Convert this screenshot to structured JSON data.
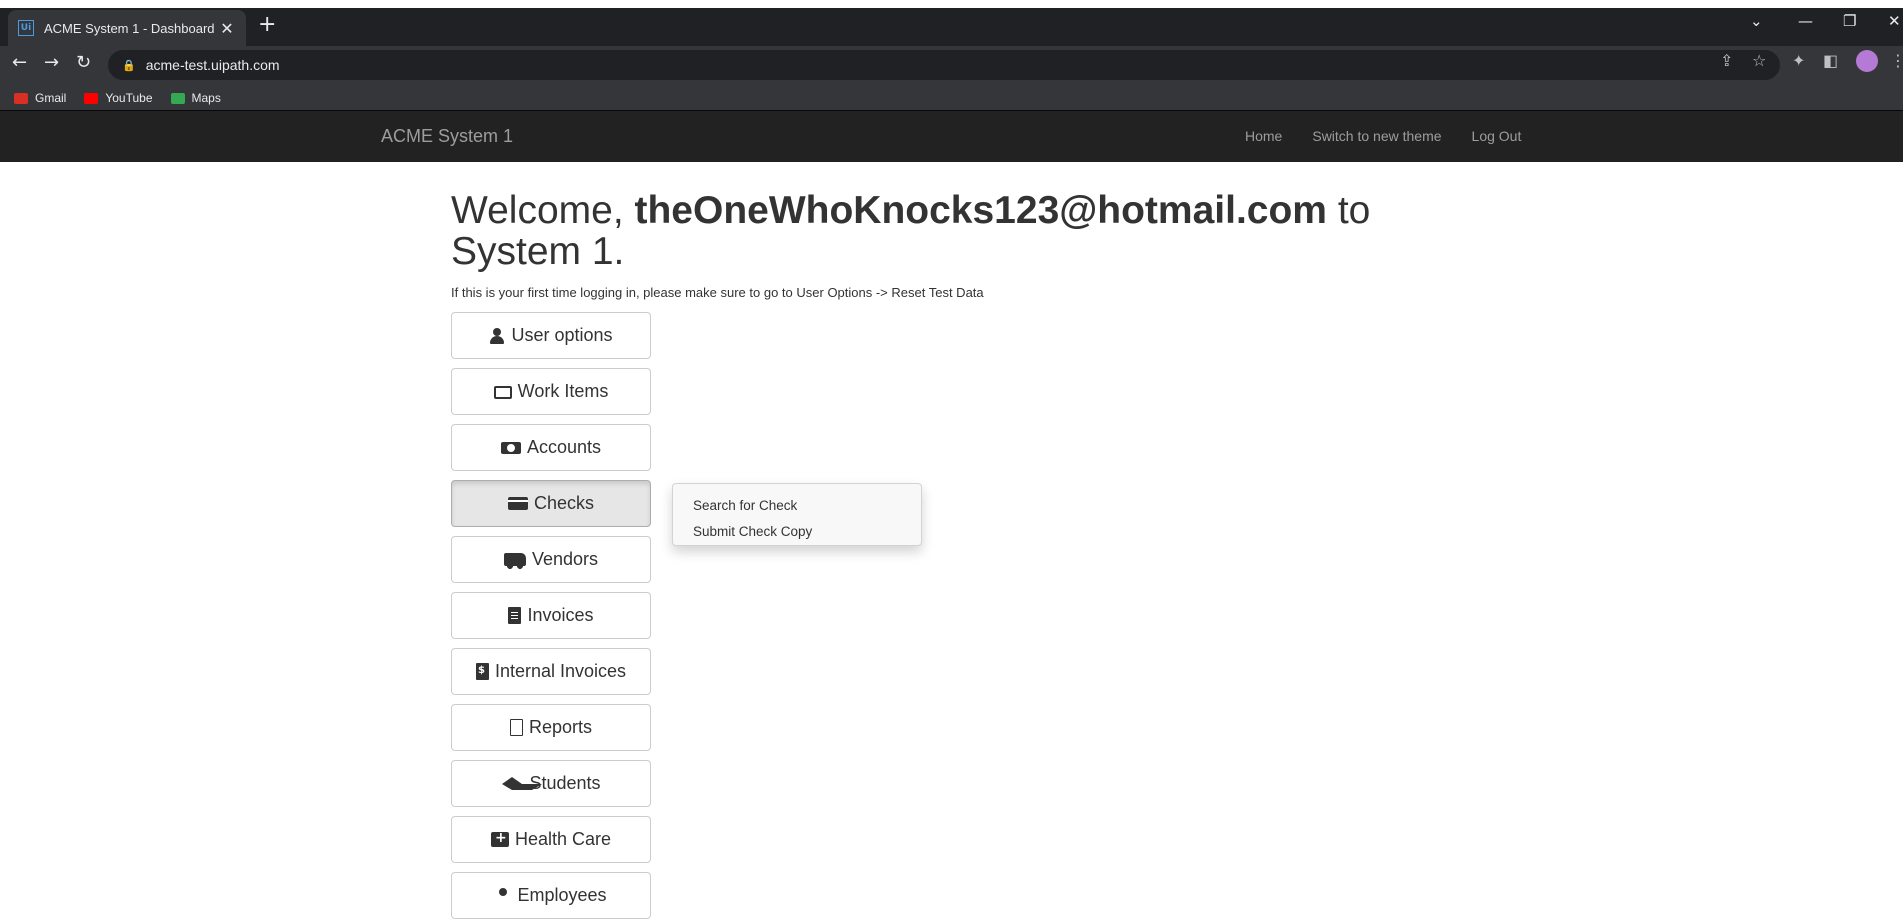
{
  "browser": {
    "tab_title": "ACME System 1 - Dashboard",
    "tab_favicon": "Ui",
    "tab_close": "✕",
    "new_tab": "+",
    "url": "acme-test.uipath.com",
    "bookmarks": [
      {
        "label": "Gmail",
        "icon": "gmail-icon",
        "color": "#d93025"
      },
      {
        "label": "YouTube",
        "icon": "youtube-icon",
        "color": "#ff0000"
      },
      {
        "label": "Maps",
        "icon": "maps-icon",
        "color": "#34a853"
      }
    ]
  },
  "navbar": {
    "brand": "ACME System 1",
    "links": [
      "Home",
      "Switch to new theme",
      "Log Out"
    ]
  },
  "main": {
    "welcome_prefix": "Welcome, ",
    "username": "theOneWhoKnocks123@hotmail.com",
    "welcome_suffix": " to System 1.",
    "info": "If this is your first time logging in, please make sure to go to User Options -> Reset Test Data",
    "menu": [
      {
        "label": "User options",
        "icon": "user-icon"
      },
      {
        "label": "Work Items",
        "icon": "folder-open-icon"
      },
      {
        "label": "Accounts",
        "icon": "money-icon"
      },
      {
        "label": "Checks",
        "icon": "credit-card-icon",
        "active": true
      },
      {
        "label": "Vendors",
        "icon": "truck-icon"
      },
      {
        "label": "Invoices",
        "icon": "invoice-icon"
      },
      {
        "label": "Internal Invoices",
        "icon": "internal-invoice-icon"
      },
      {
        "label": "Reports",
        "icon": "report-icon"
      },
      {
        "label": "Students",
        "icon": "graduation-cap-icon"
      },
      {
        "label": "Health Care",
        "icon": "medical-kit-icon"
      },
      {
        "label": "Employees",
        "icon": "employee-icon"
      }
    ]
  },
  "dropdown": {
    "items": [
      "Search for Check",
      "Submit Check Copy"
    ]
  }
}
